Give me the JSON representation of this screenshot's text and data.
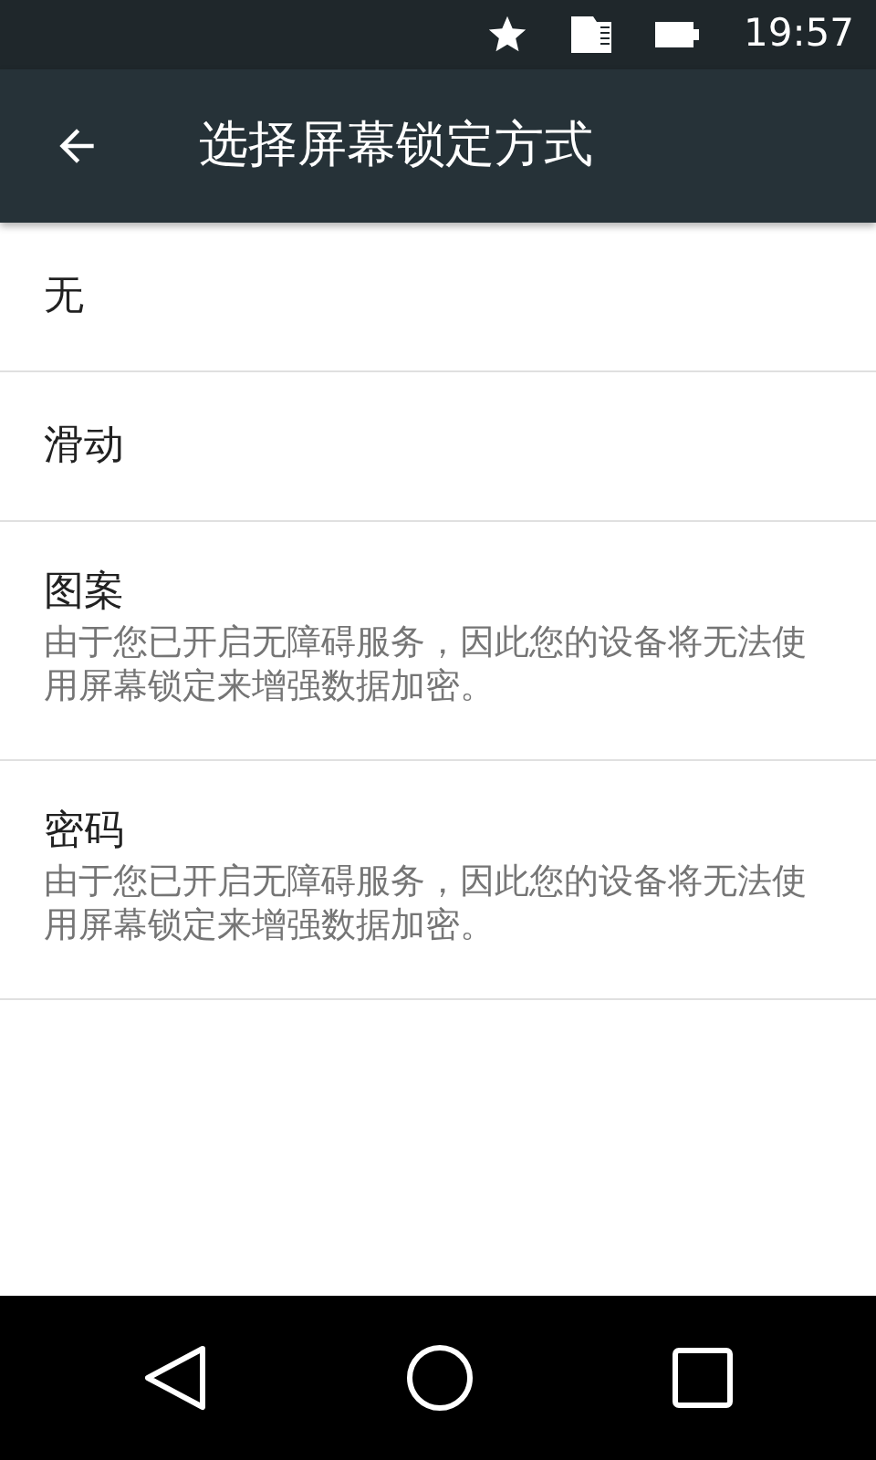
{
  "status_bar": {
    "time": "19:57"
  },
  "toolbar": {
    "title": "选择屏幕锁定方式"
  },
  "options": [
    {
      "title": "无"
    },
    {
      "title": "滑动"
    },
    {
      "title": "图案",
      "summary": "由于您已开启无障碍服务，因此您的设备将无法使用屏幕锁定来增强数据加密。"
    },
    {
      "title": "密码",
      "summary": "由于您已开启无障碍服务，因此您的设备将无法使用屏幕锁定来增强数据加密。"
    }
  ]
}
